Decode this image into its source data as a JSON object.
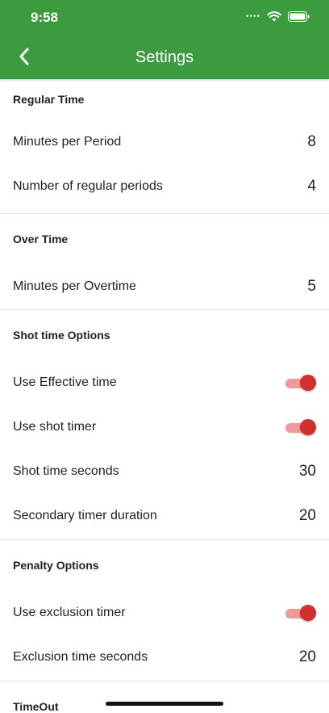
{
  "status_bar": {
    "time": "9:58"
  },
  "header": {
    "title": "Settings"
  },
  "sections": {
    "regular_time": {
      "title": "Regular Time",
      "minutes_per_period": {
        "label": "Minutes per Period",
        "value": "8"
      },
      "number_of_periods": {
        "label": "Number of regular periods",
        "value": "4"
      }
    },
    "over_time": {
      "title": "Over Time",
      "minutes_per_overtime": {
        "label": "Minutes per Overtime",
        "value": "5"
      }
    },
    "shot_time": {
      "title": "Shot time Options",
      "use_effective_time": {
        "label": "Use Effective time",
        "on": true
      },
      "use_shot_timer": {
        "label": "Use shot timer",
        "on": true
      },
      "shot_time_seconds": {
        "label": "Shot time seconds",
        "value": "30"
      },
      "secondary_timer_duration": {
        "label": "Secondary timer duration",
        "value": "20"
      }
    },
    "penalty": {
      "title": "Penalty Options",
      "use_exclusion_timer": {
        "label": "Use exclusion timer",
        "on": true
      },
      "exclusion_time_seconds": {
        "label": "Exclusion time seconds",
        "value": "20"
      }
    },
    "timeout": {
      "title": "TimeOut"
    }
  },
  "colors": {
    "header_bg": "#3c9a3f",
    "toggle_thumb": "#d32f2f",
    "toggle_track": "#ef9a9a"
  },
  "icons": {
    "back": "chevron-left-icon",
    "wifi": "wifi-icon",
    "battery": "battery-icon"
  }
}
